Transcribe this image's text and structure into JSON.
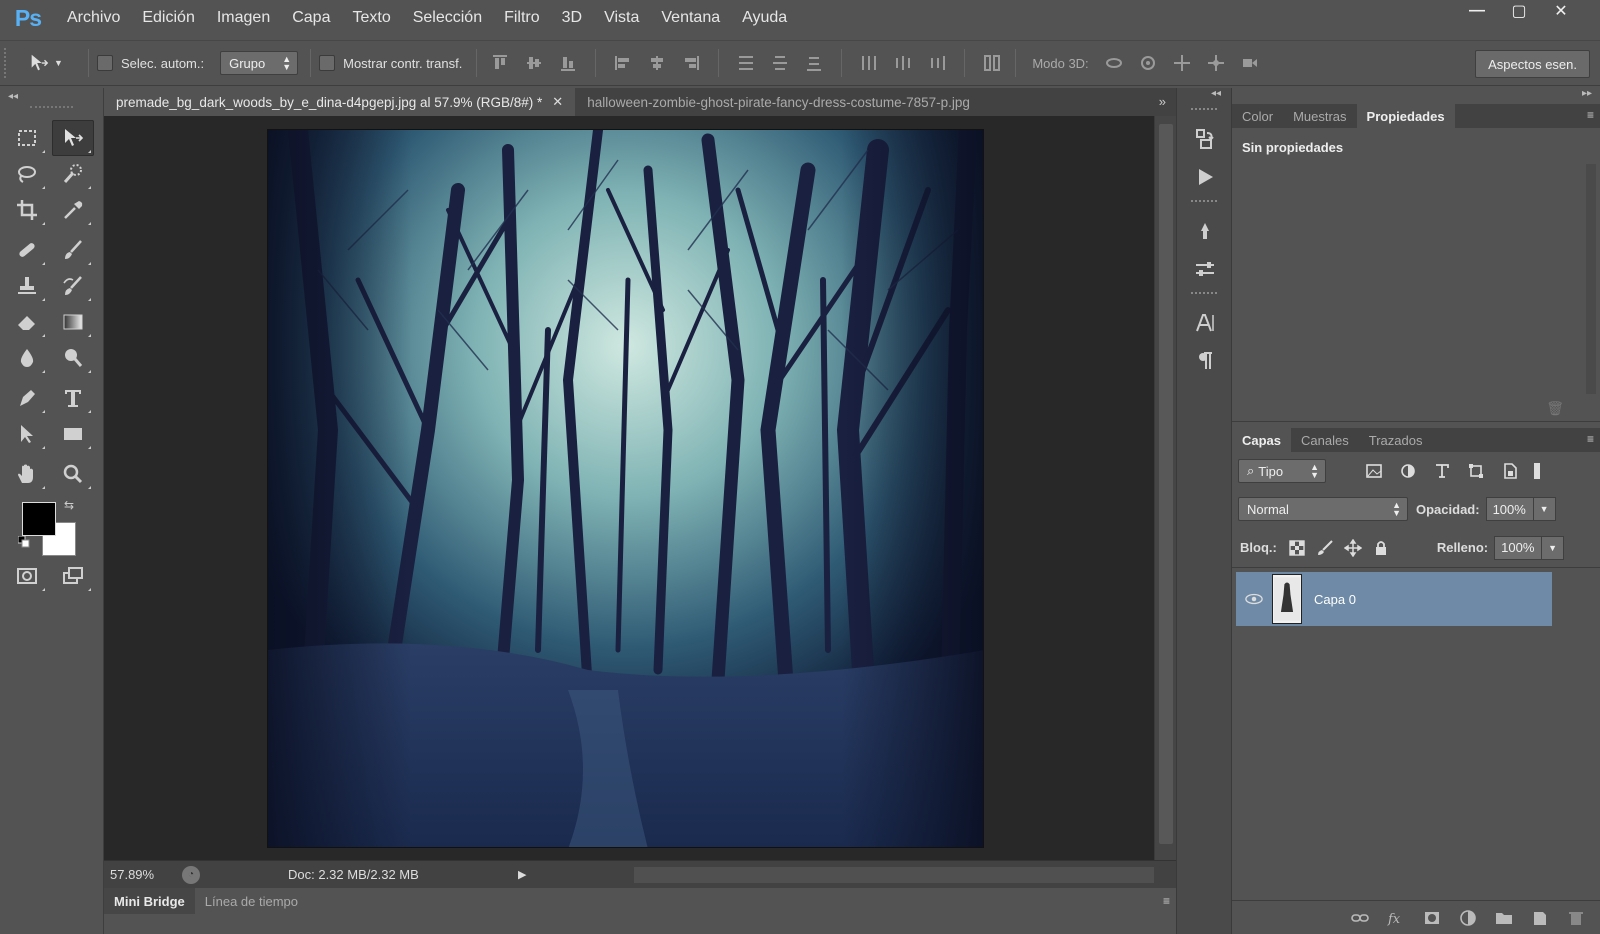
{
  "app": {
    "logo": "Ps"
  },
  "menu": [
    "Archivo",
    "Edición",
    "Imagen",
    "Capa",
    "Texto",
    "Selección",
    "Filtro",
    "3D",
    "Vista",
    "Ventana",
    "Ayuda"
  ],
  "window_controls": {
    "minimize": "—",
    "maximize": "▢",
    "close": "✕"
  },
  "options": {
    "auto_select_label": "Selec. autom.:",
    "auto_select_value": "Grupo",
    "show_transform_label": "Mostrar contr. transf.",
    "mode3d_label": "Modo 3D:",
    "workspace_label": "Aspectos esen."
  },
  "toolbar": {
    "collapse": "◂◂"
  },
  "documents": {
    "tabs": [
      {
        "label": "premade_bg_dark_woods_by_e_dina-d4pgepj.jpg al 57.9% (RGB/8#) *",
        "close": "✕"
      },
      {
        "label": "halloween-zombie-ghost-pirate-fancy-dress-costume-7857-p.jpg"
      }
    ],
    "more": "»"
  },
  "status": {
    "zoom": "57.89%",
    "doc": "Doc: 2.32 MB/2.32 MB",
    "play": "▶"
  },
  "bottom_tabs": [
    "Mini Bridge",
    "Línea de tiempo"
  ],
  "panel_menu_glyph": "≡",
  "properties": {
    "tabs": [
      "Color",
      "Muestras",
      "Propiedades"
    ],
    "body": "Sin propiedades"
  },
  "layers": {
    "tabs": [
      "Capas",
      "Canales",
      "Trazados"
    ],
    "kind_label": "Tipo",
    "blend_mode": "Normal",
    "opacity_label": "Opacidad:",
    "opacity_value": "100%",
    "lock_label": "Bloq.:",
    "fill_label": "Relleno:",
    "fill_value": "100%",
    "items": [
      {
        "name": "Capa 0"
      }
    ]
  },
  "colors": {
    "selected_layer": "#6e8aa6",
    "foreground": "#000000",
    "background": "#ffffff"
  }
}
